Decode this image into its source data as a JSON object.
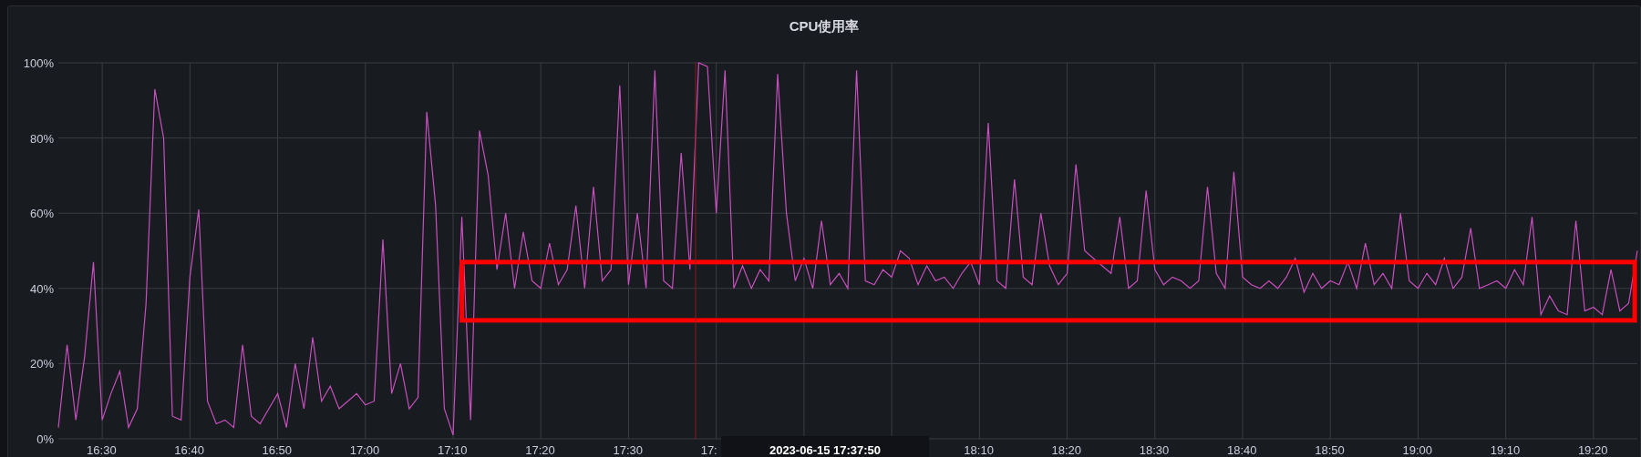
{
  "panel": {
    "title": "CPU使用率",
    "chart_data": {
      "type": "line",
      "grid": true,
      "ylim": [
        0,
        100
      ],
      "yticks": [
        {
          "value": 0,
          "label": "0%"
        },
        {
          "value": 20,
          "label": "20%"
        },
        {
          "value": 40,
          "label": "40%"
        },
        {
          "value": 60,
          "label": "60%"
        },
        {
          "value": 80,
          "label": "80%"
        },
        {
          "value": 100,
          "label": "100%"
        }
      ],
      "categories": [
        null,
        null,
        null,
        null,
        null,
        "16:30",
        null,
        null,
        null,
        null,
        null,
        null,
        null,
        null,
        null,
        "16:40",
        null,
        null,
        null,
        null,
        null,
        null,
        null,
        null,
        null,
        "16:50",
        null,
        null,
        null,
        null,
        null,
        null,
        null,
        null,
        null,
        "17:00",
        null,
        null,
        null,
        null,
        null,
        null,
        null,
        null,
        null,
        "17:10",
        null,
        null,
        null,
        null,
        null,
        null,
        null,
        null,
        null,
        "17:20",
        null,
        null,
        null,
        null,
        null,
        null,
        null,
        null,
        null,
        "17:30",
        null,
        null,
        null,
        null,
        null,
        null,
        null,
        null,
        null,
        null,
        null,
        null,
        null,
        null,
        null,
        null,
        null,
        null,
        null,
        null,
        null,
        null,
        null,
        null,
        null,
        null,
        null,
        null,
        null,
        null,
        null,
        null,
        null,
        null,
        null,
        null,
        null,
        null,
        null,
        "18:10",
        null,
        null,
        null,
        null,
        null,
        null,
        null,
        null,
        null,
        "18:20",
        null,
        null,
        null,
        null,
        null,
        null,
        null,
        null,
        null,
        "18:30",
        null,
        null,
        null,
        null,
        null,
        null,
        null,
        null,
        null,
        "18:40",
        null,
        null,
        null,
        null,
        null,
        null,
        null,
        null,
        null,
        "18:50",
        null,
        null,
        null,
        null,
        null,
        null,
        null,
        null,
        null,
        "19:00",
        null,
        null,
        null,
        null,
        null,
        null,
        null,
        null,
        null,
        "19:10",
        null,
        null,
        null,
        null,
        null,
        null,
        null,
        null,
        null,
        "19:20",
        null,
        null,
        null,
        null,
        null
      ],
      "series": [
        {
          "color": "#c84fbf",
          "values": [
            3,
            25,
            5,
            22,
            47,
            5,
            12,
            18,
            3,
            8,
            36,
            93,
            80,
            6,
            5,
            43,
            61,
            10,
            4,
            5,
            3,
            25,
            6,
            4,
            8,
            12,
            3,
            20,
            8,
            27,
            10,
            14,
            8,
            10,
            12,
            9,
            10,
            53,
            12,
            20,
            8,
            11,
            87,
            62,
            8,
            1,
            59,
            5,
            82,
            70,
            45,
            60,
            40,
            55,
            42,
            40,
            52,
            41,
            45,
            62,
            40,
            67,
            42,
            45,
            94,
            41,
            60,
            40,
            98,
            42,
            40,
            76,
            45,
            100,
            99,
            60,
            98,
            40,
            46,
            40,
            45,
            42,
            97,
            60,
            42,
            48,
            40,
            58,
            41,
            44,
            40,
            98,
            42,
            41,
            45,
            43,
            50,
            48,
            41,
            46,
            42,
            43,
            40,
            44,
            47,
            41,
            84,
            42,
            40,
            69,
            43,
            41,
            60,
            46,
            41,
            44,
            73,
            50,
            48,
            46,
            44,
            59,
            40,
            42,
            66,
            45,
            41,
            43,
            42,
            40,
            42,
            67,
            44,
            40,
            71,
            43,
            41,
            40,
            42,
            40,
            43,
            48,
            39,
            44,
            40,
            42,
            41,
            47,
            40,
            52,
            41,
            44,
            40,
            60,
            42,
            40,
            44,
            41,
            48,
            40,
            43,
            56,
            40,
            41,
            42,
            40,
            45,
            41,
            59,
            33,
            38,
            34,
            33,
            58,
            34,
            35,
            33,
            45,
            34,
            36,
            50
          ]
        }
      ]
    },
    "partial_axis_label": "17:",
    "tooltip": {
      "text": "2023-06-15 17:37:50"
    }
  }
}
